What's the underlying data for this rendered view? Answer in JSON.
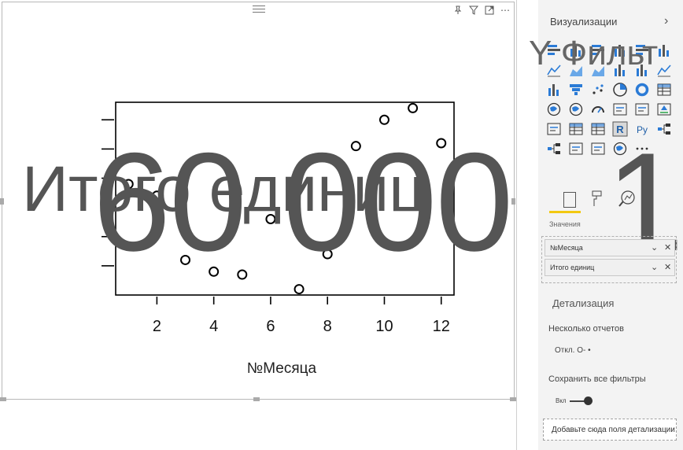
{
  "visual_toolbar": {
    "pin_icon": "pin-icon",
    "filter_icon": "filter-icon",
    "focus_icon": "focus-mode-icon",
    "more_label": "⋯"
  },
  "chart_data": {
    "type": "scatter",
    "x": [
      1,
      2,
      3,
      4,
      5,
      6,
      7,
      8,
      9,
      10,
      11,
      12
    ],
    "y": [
      48000,
      44000,
      22000,
      18000,
      17000,
      36000,
      12000,
      24000,
      61000,
      70000,
      74000,
      62000
    ],
    "xlabel": "№Месяца",
    "ylabel": "Итого единиц",
    "xticks": [
      "2",
      "4",
      "6",
      "8",
      "10",
      "12"
    ],
    "ytick_text": "60 000",
    "grid": false
  },
  "overlay": {
    "ylabel_big": "Итого единиц",
    "ytick_big": "60 000",
    "ytick_big_2": "1",
    "filters_big": "Y Фильт"
  },
  "pane": {
    "title": "Визуализации",
    "chevron": "›",
    "tabs": {
      "fields_label": "Значения"
    },
    "wells": [
      {
        "label": "№Месяца",
        "chevron": "⌄",
        "close": "✕"
      },
      {
        "label": "Итого единиц",
        "chevron": "⌄",
        "close": "✕"
      }
    ],
    "drillthrough_title": "Детализация",
    "cross_report_label": "Несколько отчетов",
    "cross_report_value": "Откл. О- •",
    "keep_filters_label": "Сохранить все фильтры",
    "keep_filters_value": "Вкл",
    "drop_hint": "Добавьте сюда поля детализации"
  }
}
